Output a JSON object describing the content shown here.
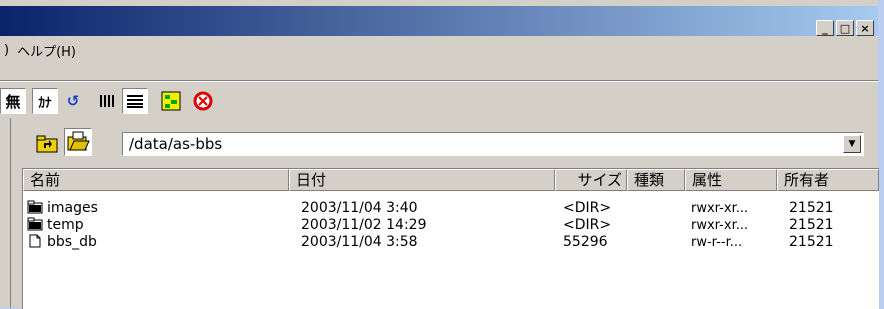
{
  "window": {
    "minimize": "_",
    "maximize": "□",
    "close": "×"
  },
  "menu": {
    "items": [
      ")",
      "ヘルプ(H)"
    ]
  },
  "toolbar": {
    "buttons": [
      {
        "name": "no-conversion",
        "glyph": "無"
      },
      {
        "name": "katakana",
        "glyph": "ｶﾅ"
      },
      {
        "name": "refresh",
        "glyph": "↺"
      },
      {
        "name": "list-view",
        "glyph": "☰"
      },
      {
        "name": "detail-view",
        "glyph": "☷"
      },
      {
        "name": "tree",
        "glyph": "⊞"
      },
      {
        "name": "stop",
        "glyph": "⊗"
      }
    ]
  },
  "pathbar": {
    "path": "/data/as-bbs"
  },
  "columns": [
    "名前",
    "日付",
    "サイズ",
    "種類",
    "属性",
    "所有者"
  ],
  "files": [
    {
      "icon": "folder",
      "name": "images",
      "date": "2003/11/04  3:40",
      "size": "<DIR>",
      "type": "",
      "attr": "rwxr-xr...",
      "owner": "21521"
    },
    {
      "icon": "folder",
      "name": "temp",
      "date": "2003/11/02 14:29",
      "size": "<DIR>",
      "type": "",
      "attr": "rwxr-xr...",
      "owner": "21521"
    },
    {
      "icon": "file",
      "name": "bbs_db",
      "date": "2003/11/04  3:58",
      "size": "55296",
      "type": "",
      "attr": "rw-r--r...",
      "owner": "21521"
    }
  ],
  "colors": {
    "title_start": "#0a246a",
    "title_end": "#a6caf0",
    "face": "#d4d0c8"
  }
}
